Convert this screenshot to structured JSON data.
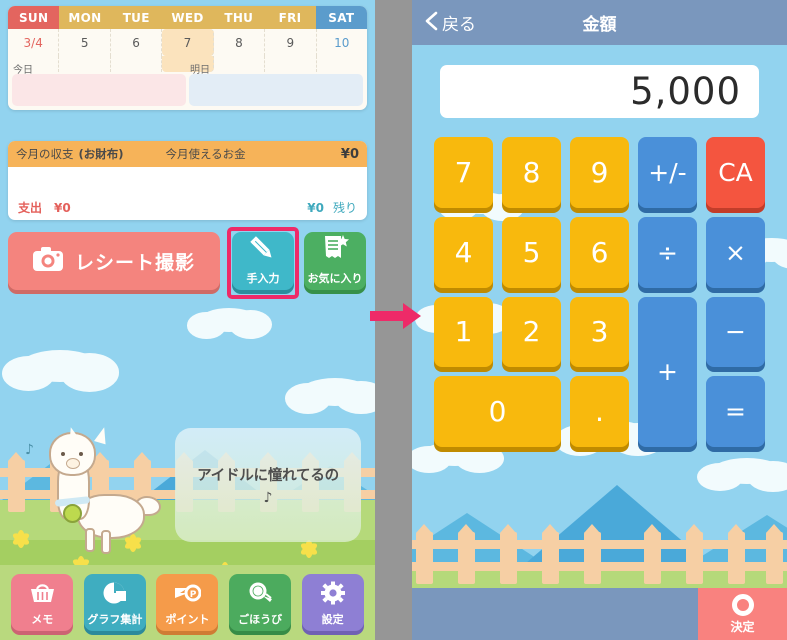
{
  "left_app": {
    "calendar": {
      "weekdays": [
        "SUN",
        "MON",
        "TUE",
        "WED",
        "THU",
        "FRI",
        "SAT"
      ],
      "dates": [
        "3/4",
        "5",
        "6",
        "7",
        "8",
        "9",
        "10"
      ],
      "today_index": 3,
      "memo_today_label": "今日",
      "memo_tomorrow_label": "明日"
    },
    "balance": {
      "header_title": "今月の収支",
      "header_wallet": "(お財布)",
      "header_usable": "今月使えるお金",
      "header_amount": "¥0",
      "expense_label": "支出",
      "expense_amount": "¥0",
      "remaining_amount": "¥0",
      "remaining_label": "残り"
    },
    "actions": {
      "receipt_label": "レシート撮影",
      "receipt_icon": "camera-icon",
      "manual_label": "手入力",
      "manual_icon": "pencil-icon",
      "favorite_label": "お気に入り",
      "favorite_icon": "receipt-star-icon"
    },
    "character": {
      "speech_text": "アイドルに憧れてるの",
      "speech_note": "♪"
    },
    "bottom_nav": [
      {
        "label": "メモ",
        "icon": "basket-icon",
        "color": "#f07f8e",
        "shadow": "#cc6373"
      },
      {
        "label": "グラフ集計",
        "icon": "pie-chart-icon",
        "color": "#3fadc0",
        "shadow": "#2d8a9b"
      },
      {
        "label": "ポイント",
        "icon": "point-card-icon",
        "color": "#f59b4a",
        "shadow": "#cf7c34"
      },
      {
        "label": "ごほうび",
        "icon": "medal-icon",
        "color": "#4cab5e",
        "shadow": "#378c47"
      },
      {
        "label": "設定",
        "icon": "gear-icon",
        "color": "#8e7fd4",
        "shadow": "#6f61b3"
      }
    ]
  },
  "right_app": {
    "header": {
      "back_label": "戻る",
      "back_icon": "chevron-left-icon",
      "title": "金額"
    },
    "display": {
      "value": "5,000"
    },
    "keypad": [
      {
        "label": "7",
        "type": "num"
      },
      {
        "label": "8",
        "type": "num"
      },
      {
        "label": "9",
        "type": "num"
      },
      {
        "label": "+/-",
        "type": "op"
      },
      {
        "label": "CA",
        "type": "ca"
      },
      {
        "label": "4",
        "type": "num"
      },
      {
        "label": "5",
        "type": "num"
      },
      {
        "label": "6",
        "type": "num"
      },
      {
        "label": "÷",
        "type": "op"
      },
      {
        "label": "×",
        "type": "op"
      },
      {
        "label": "1",
        "type": "num"
      },
      {
        "label": "2",
        "type": "num"
      },
      {
        "label": "3",
        "type": "num"
      },
      {
        "label": "+",
        "type": "op",
        "span": "tall2"
      },
      {
        "label": "−",
        "type": "op"
      },
      {
        "label": "0",
        "type": "num",
        "span": "wide2"
      },
      {
        "label": ".",
        "type": "num"
      },
      {
        "label": "=",
        "type": "op"
      }
    ],
    "footer": {
      "confirm_label": "決定",
      "confirm_icon": "circle-ring-icon"
    }
  },
  "annotation": {
    "arrow_icon": "right-arrow-icon",
    "arrow_color": "#ee2a68",
    "highlight_color": "#ee2a68"
  }
}
